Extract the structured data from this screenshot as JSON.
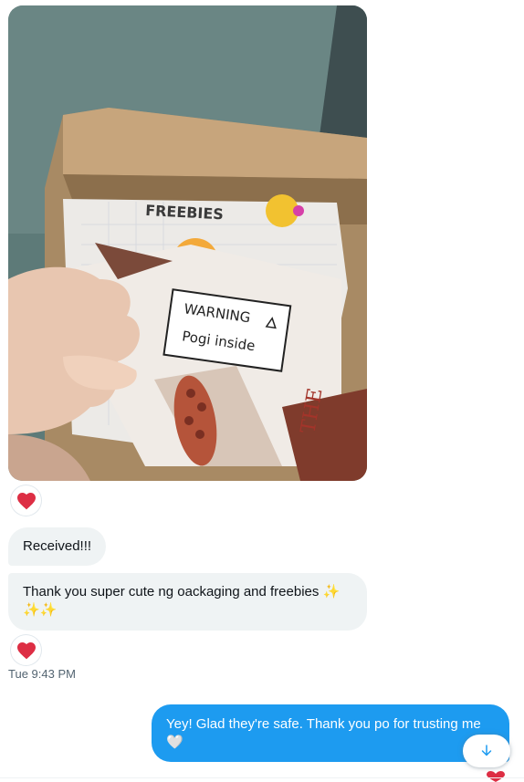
{
  "conversation": {
    "image_message": {
      "alt": "Photo of a paper envelope with a WARNING Pogi inside label held in front of a cardboard box",
      "photo_text": {
        "freebies": "FREEBIES",
        "warning": "WARNING",
        "pogi": "Pogi inside"
      },
      "reaction_icon": "red-heart"
    },
    "incoming": [
      {
        "text": "Received!!!"
      },
      {
        "text_main": "Thank you super cute ng oackaging and freebies",
        "sparkles_1": "✨",
        "sparkles_2": "✨✨",
        "reaction_icon": "red-heart"
      }
    ],
    "timestamp": "Tue 9:43 PM",
    "outgoing": {
      "text": "Yey! Glad they're safe. Thank you po for trusting me",
      "emoji": "🤍"
    },
    "scroll_down_icon": "arrow-down-icon"
  },
  "colors": {
    "incoming_bg": "#eff3f4",
    "outgoing_bg": "#1d9bf0",
    "heart": "#f91880",
    "accent": "#1d9bf0"
  }
}
